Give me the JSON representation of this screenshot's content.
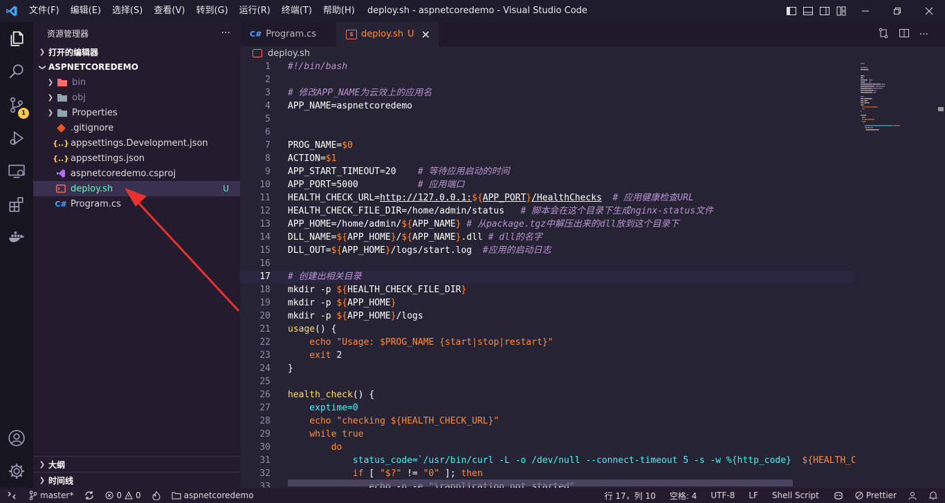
{
  "titlebar": {
    "menu": [
      "文件(F)",
      "编辑(E)",
      "选择(S)",
      "查看(V)",
      "转到(G)",
      "运行(R)",
      "终端(T)",
      "帮助(H)"
    ],
    "title": "deploy.sh - aspnetcoredemo - Visual Studio Code"
  },
  "sidebar": {
    "title": "资源管理器",
    "more": "···",
    "open_editors": "打开的编辑器",
    "project": "ASPNETCOREDEMO",
    "items": [
      {
        "name": "bin",
        "kind": "folder",
        "icon": "bin-folder-icon",
        "color": "#ff6b6b",
        "dim": true
      },
      {
        "name": "obj",
        "kind": "folder",
        "icon": "folder-icon",
        "color": "#90a4ae",
        "dim": true
      },
      {
        "name": "Properties",
        "kind": "folder",
        "icon": "folder-icon",
        "color": "#90a4ae",
        "dim": false
      },
      {
        "name": ".gitignore",
        "kind": "file",
        "icon": "git-icon",
        "color": "#f4511e"
      },
      {
        "name": "appsettings.Development.json",
        "kind": "file",
        "icon": "json-icon",
        "color": "#f9c74f"
      },
      {
        "name": "appsettings.json",
        "kind": "file",
        "icon": "json-icon",
        "color": "#f9c74f"
      },
      {
        "name": "aspnetcoredemo.csproj",
        "kind": "file",
        "icon": "vs-icon",
        "color": "#b16cf0"
      },
      {
        "name": "deploy.sh",
        "kind": "file",
        "icon": "terminal-icon",
        "color": "#ff6e40",
        "selected": true,
        "git": "U"
      },
      {
        "name": "Program.cs",
        "kind": "file",
        "icon": "csharp-icon",
        "color": "#4aa8ff"
      }
    ],
    "outline": "大纲",
    "timeline": "时间线"
  },
  "activity": {
    "badge": "1"
  },
  "tabs": [
    {
      "lang": "C#",
      "label": "Program.cs",
      "active": false
    },
    {
      "lang": "$",
      "label": "deploy.sh",
      "active": true,
      "git": "U",
      "close": "×"
    }
  ],
  "breadcrumb": "deploy.sh",
  "editor": {
    "current_line": 17,
    "lines": [
      [
        [
          "#!/bin/bash",
          "c"
        ]
      ],
      [],
      [
        [
          "# 修改APP_NAME为云效上的应用名",
          "c"
        ]
      ],
      [
        [
          "APP_NAME=aspnetcoredemo",
          "w"
        ]
      ],
      [],
      [],
      [
        [
          "PROG_NAME=",
          "w"
        ],
        [
          "$0",
          "o"
        ]
      ],
      [
        [
          "ACTION=",
          "w"
        ],
        [
          "$1",
          "o"
        ]
      ],
      [
        [
          "APP_START_TIMEOUT=20",
          "w"
        ],
        [
          "    # 等待应用启动的时间",
          "c"
        ]
      ],
      [
        [
          "APP_PORT=5000",
          "w"
        ],
        [
          "           # 应用端口",
          "c"
        ]
      ],
      [
        [
          "HEALTH_CHECK_URL=",
          "w"
        ],
        [
          "http://127.0.0.1:",
          "u"
        ],
        [
          "${",
          "o"
        ],
        [
          "APP_PORT",
          "u"
        ],
        [
          "}",
          "o"
        ],
        [
          "/HealthChecks",
          "u"
        ],
        [
          "  # 应用健康检查URL",
          "c"
        ]
      ],
      [
        [
          "HEALTH_CHECK_FILE_DIR=/home/admin/status",
          "w"
        ],
        [
          "   # 脚本会在这个目录下生成nginx-status文件",
          "c"
        ]
      ],
      [
        [
          "APP_HOME=/home/admin/",
          "w"
        ],
        [
          "${",
          "o"
        ],
        [
          "APP_NAME",
          "w"
        ],
        [
          "}",
          "o"
        ],
        [
          " # 从package.tgz中解压出来的dll放到这个目录下",
          "c"
        ]
      ],
      [
        [
          "DLL_NAME=",
          "w"
        ],
        [
          "${",
          "o"
        ],
        [
          "APP_HOME",
          "w"
        ],
        [
          "}",
          "o"
        ],
        [
          "/",
          "w"
        ],
        [
          "${",
          "o"
        ],
        [
          "APP_NAME",
          "w"
        ],
        [
          "}",
          "o"
        ],
        [
          ".dll",
          "w"
        ],
        [
          " # dll的名字",
          "c"
        ]
      ],
      [
        [
          "DLL_OUT=",
          "w"
        ],
        [
          "${",
          "o"
        ],
        [
          "APP_HOME",
          "w"
        ],
        [
          "}",
          "o"
        ],
        [
          "/logs/start.log",
          "w"
        ],
        [
          "  #应用的启动日志",
          "c"
        ]
      ],
      [],
      [
        [
          "# 创建出相关目录",
          "c"
        ]
      ],
      [
        [
          "mkdir -p ",
          "w"
        ],
        [
          "${",
          "o"
        ],
        [
          "HEALTH_CHECK_FILE_DIR",
          "w"
        ],
        [
          "}",
          "o"
        ]
      ],
      [
        [
          "mkdir -p ",
          "w"
        ],
        [
          "${",
          "o"
        ],
        [
          "APP_HOME",
          "w"
        ],
        [
          "}",
          "o"
        ]
      ],
      [
        [
          "mkdir -p ",
          "w"
        ],
        [
          "${",
          "o"
        ],
        [
          "APP_HOME",
          "w"
        ],
        [
          "}",
          "o"
        ],
        [
          "/logs",
          "w"
        ]
      ],
      [
        [
          "usage",
          "y"
        ],
        [
          "() {",
          "w"
        ]
      ],
      [
        [
          "    ",
          "w"
        ],
        [
          "echo",
          "o"
        ],
        [
          " \"Usage: ",
          "s"
        ],
        [
          "$PROG_NAME",
          "s"
        ],
        [
          " {start|stop|restart}\"",
          "s"
        ]
      ],
      [
        [
          "    ",
          "w"
        ],
        [
          "exit",
          "o"
        ],
        [
          " 2",
          "w"
        ]
      ],
      [
        [
          "}",
          "w"
        ]
      ],
      [],
      [
        [
          "health_check",
          "y"
        ],
        [
          "() {",
          "w"
        ]
      ],
      [
        [
          "    exptime=0",
          "b"
        ]
      ],
      [
        [
          "    ",
          "w"
        ],
        [
          "echo",
          "o"
        ],
        [
          " \"checking ",
          "s"
        ],
        [
          "${HEALTH_CHECK_URL}",
          "s"
        ],
        [
          "\"",
          "s"
        ]
      ],
      [
        [
          "    ",
          "w"
        ],
        [
          "while",
          "o"
        ],
        [
          " true",
          "o"
        ]
      ],
      [
        [
          "        ",
          "w"
        ],
        [
          "do",
          "o"
        ]
      ],
      [
        [
          "            status_code=`/usr/bin/curl -L -o /dev/null --connect-timeout 5 -s -w %{http_code}  ",
          "b"
        ],
        [
          "${HEALTH_CHECK_URL}",
          "s"
        ]
      ],
      [
        [
          "            ",
          "w"
        ],
        [
          "if",
          "o"
        ],
        [
          " [ ",
          "w"
        ],
        [
          "\"$?\"",
          "s"
        ],
        [
          " != ",
          "w"
        ],
        [
          "\"0\"",
          "s"
        ],
        [
          " ]; ",
          "w"
        ],
        [
          "then",
          "o"
        ]
      ],
      [
        [
          "               echo -n -e \"\\rapplication not started\"",
          "w"
        ]
      ]
    ]
  },
  "status": {
    "branch": "master*",
    "errors": "0",
    "warnings": "0",
    "project": "aspnetcoredemo",
    "position": "行 17，列 10",
    "spaces": "空格: 4",
    "encoding": "UTF-8",
    "eol": "LF",
    "language": "Shell Script",
    "formatter": "Prettier"
  },
  "colors": {
    "comment": "#b893ce",
    "keyword": "#fede5d",
    "orange": "#ff8b39",
    "string": "#ff8b39",
    "function": "#fede5d",
    "variable": "#36f9f6",
    "arrow": "#e8322e"
  }
}
